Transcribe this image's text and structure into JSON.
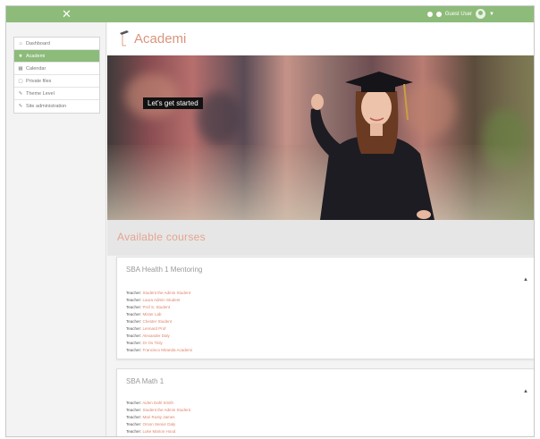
{
  "topbar": {
    "close_symbol": "✕",
    "user_label": "Guest User",
    "icons": [
      "globe-icon",
      "bell-icon",
      "user-avatar-icon",
      "caret-down-icon"
    ]
  },
  "sidebar": {
    "items": [
      {
        "icon": "home-icon",
        "glyph": "⌂",
        "label": "Dashboard",
        "active": false
      },
      {
        "icon": "star-icon",
        "glyph": "★",
        "label": "Academi",
        "active": true
      },
      {
        "icon": "calendar-icon",
        "glyph": "▦",
        "label": "Calendar",
        "active": false
      },
      {
        "icon": "file-icon",
        "glyph": "▢",
        "label": "Private files",
        "active": false
      },
      {
        "icon": "wrench-icon",
        "glyph": "✎",
        "label": "Theme Level",
        "active": false
      },
      {
        "icon": "wrench-icon",
        "glyph": "✎",
        "label": "Site administration",
        "active": false
      }
    ]
  },
  "brand": {
    "name": "Academi"
  },
  "hero": {
    "tagline": "Let's get started"
  },
  "section": {
    "title": "Available courses"
  },
  "courses": [
    {
      "title": "SBA Health 1 Mentoring",
      "teachers": [
        {
          "label": "Teacher:",
          "name": "Student the Admin Student"
        },
        {
          "label": "Teacher:",
          "name": "Laura Admin Student"
        },
        {
          "label": "Teacher:",
          "name": "Prof S. Student"
        },
        {
          "label": "Teacher:",
          "name": "Mister Lab"
        },
        {
          "label": "Teacher:",
          "name": "Chester Student"
        },
        {
          "label": "Teacher:",
          "name": "Lennard Prof"
        },
        {
          "label": "Teacher:",
          "name": "Alexander Daly"
        },
        {
          "label": "Teacher:",
          "name": "Dr Os Tinly"
        },
        {
          "label": "Teacher:",
          "name": "Francisco Miranda Academi"
        }
      ]
    },
    {
      "title": "SBA Math 1",
      "teachers": [
        {
          "label": "Teacher:",
          "name": "Aiden Dahl Smith"
        },
        {
          "label": "Teacher:",
          "name": "Student the Admin Student"
        },
        {
          "label": "Teacher:",
          "name": "Mari Rusty James"
        },
        {
          "label": "Teacher:",
          "name": "Orson Senior Daly"
        },
        {
          "label": "Teacher:",
          "name": "Luke Marion Hood"
        }
      ]
    }
  ],
  "colors": {
    "accent": "#8dbb7a",
    "link": "#e0836a",
    "brand": "#d9957c"
  }
}
